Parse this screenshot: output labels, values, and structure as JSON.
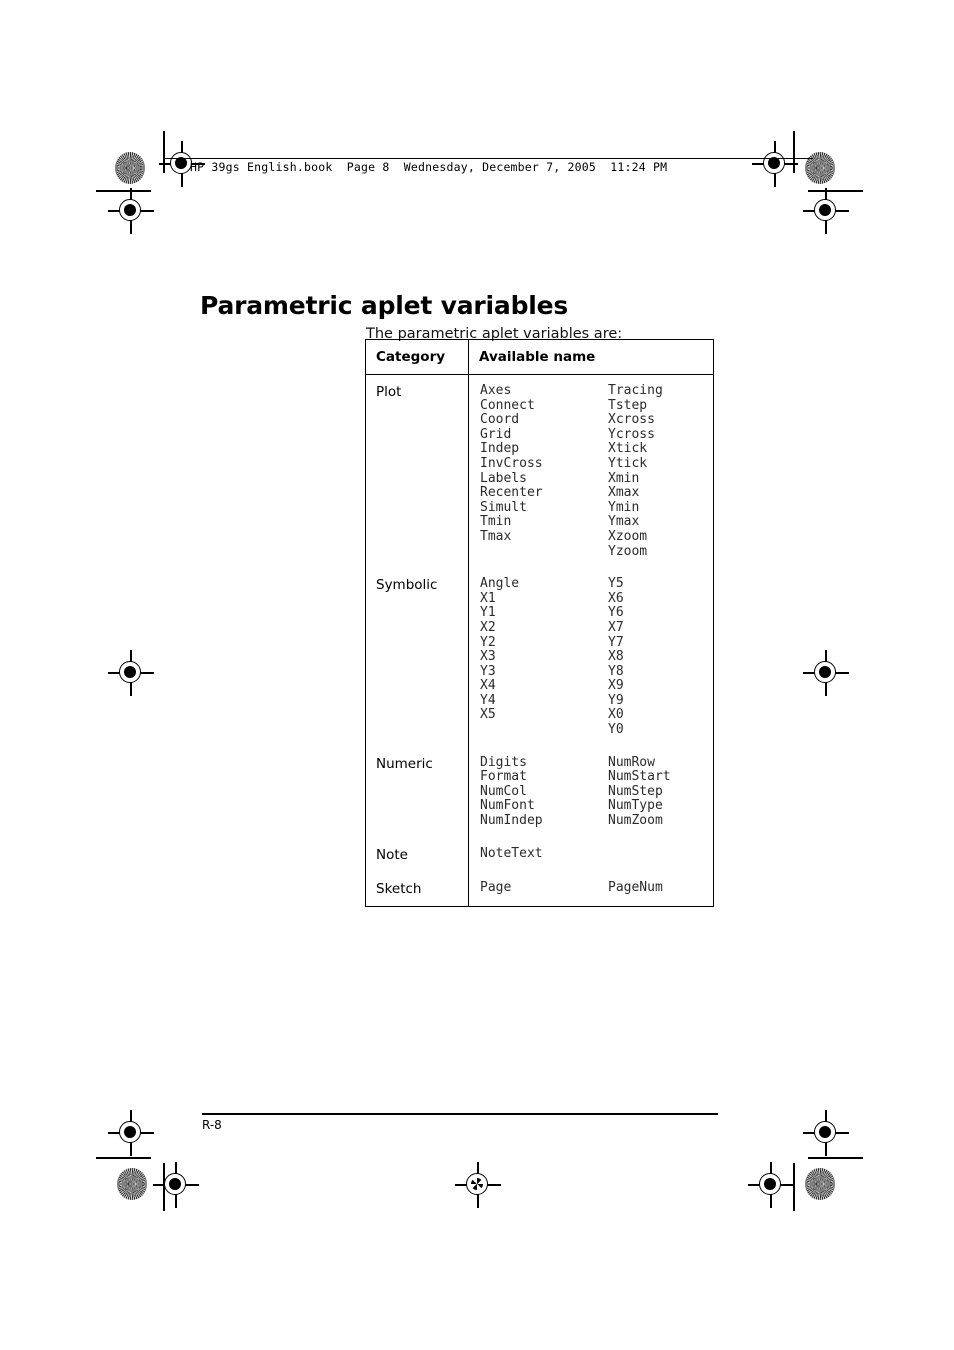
{
  "header": {
    "book_line": "HP 39gs English.book  Page 8  Wednesday, December 7, 2005  11:24 PM"
  },
  "content": {
    "title": "Parametric aplet variables",
    "intro": "The parametric aplet variables are:"
  },
  "table": {
    "columns": [
      "Category",
      "Available name"
    ],
    "rows": [
      {
        "category": "Plot",
        "left": [
          "Axes",
          "Connect",
          "Coord",
          "Grid",
          "Indep",
          "InvCross",
          "Labels",
          "Recenter",
          "Simult",
          "Tmin",
          "Tmax"
        ],
        "right": [
          "Tracing",
          "Tstep",
          "Xcross",
          "Ycross",
          "Xtick",
          "Ytick",
          "Xmin",
          "Xmax",
          "Ymin",
          "Ymax",
          "Xzoom",
          "Yzoom"
        ]
      },
      {
        "category": "Symbolic",
        "left": [
          "Angle",
          "X1",
          "Y1",
          "X2",
          "Y2",
          "X3",
          "Y3",
          "X4",
          "Y4",
          "X5"
        ],
        "right": [
          "Y5",
          "X6",
          "Y6",
          "X7",
          "Y7",
          "X8",
          "Y8",
          "X9",
          "Y9",
          "X0",
          "Y0"
        ]
      },
      {
        "category": "Numeric",
        "left": [
          "Digits",
          "Format",
          "NumCol",
          "NumFont",
          "NumIndep"
        ],
        "right": [
          "NumRow",
          "NumStart",
          "NumStep",
          "NumType",
          "NumZoom"
        ]
      },
      {
        "category": "Note",
        "left": [
          "NoteText"
        ],
        "right": []
      },
      {
        "category": "Sketch",
        "left": [
          "Page"
        ],
        "right": [
          "PageNum"
        ]
      }
    ]
  },
  "footer": {
    "page_number": "R-8"
  }
}
